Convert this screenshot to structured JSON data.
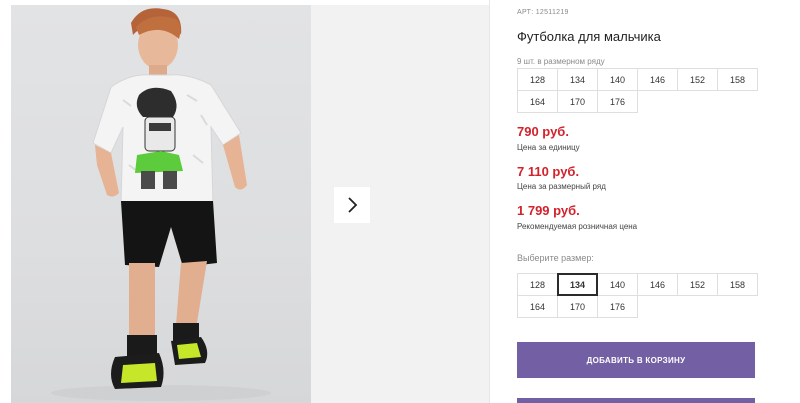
{
  "gallery": {
    "next_icon": "chevron-right-icon"
  },
  "product": {
    "sku": "АРТ: 12511219",
    "title": "Футболка для мальчика",
    "set_note": "9 шт. в размерном ряду",
    "set_sizes": [
      "128",
      "134",
      "140",
      "146",
      "152",
      "158",
      "164",
      "170",
      "176"
    ],
    "prices": {
      "unit_price": "790 руб.",
      "unit_label": "Цена за единицу",
      "set_price": "7 110 руб.",
      "set_label": "Цена за размерный ряд",
      "retail_price": "1 799 руб.",
      "retail_label": "Рекомендуемая розничная цена"
    },
    "choose_size_label": "Выберите размер:",
    "choose_sizes": [
      "128",
      "134",
      "140",
      "146",
      "152",
      "158",
      "164",
      "170",
      "176"
    ],
    "selected_size": "134",
    "add_to_cart_label": "ДОБАВИТЬ В КОРЗИНУ"
  },
  "colors": {
    "price_red": "#d2222c",
    "accent_purple": "#7360a4"
  }
}
